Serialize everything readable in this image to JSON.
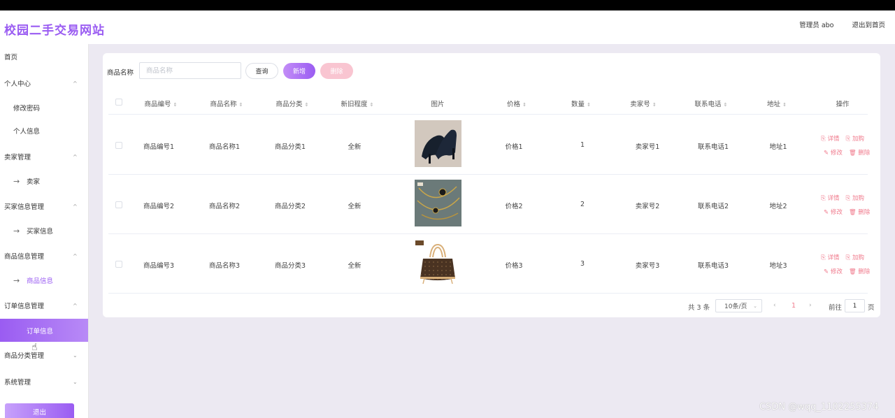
{
  "header": {
    "site_title": "校园二手交易网站",
    "admin_label": "管理员 abo",
    "exit_label": "退出到首页"
  },
  "sidebar": {
    "items": [
      {
        "label": "首页"
      },
      {
        "label": "个人中心"
      },
      {
        "label": "修改密码"
      },
      {
        "label": "个人信息"
      },
      {
        "label": "卖家管理"
      },
      {
        "label": "卖家"
      },
      {
        "label": "买家信息管理"
      },
      {
        "label": "买家信息"
      },
      {
        "label": "商品信息管理"
      },
      {
        "label": "商品信息"
      },
      {
        "label": "订单信息管理"
      },
      {
        "label": "订单信息"
      },
      {
        "label": "商品分类管理"
      },
      {
        "label": "系统管理"
      }
    ],
    "logout_label": "退出"
  },
  "search": {
    "label": "商品名称",
    "placeholder": "商品名称",
    "query_label": "查询",
    "add_label": "新增",
    "delete_label": "删除"
  },
  "table": {
    "columns": [
      "商品编号",
      "商品名称",
      "商品分类",
      "新旧程度",
      "图片",
      "价格",
      "数量",
      "卖家号",
      "联系电话",
      "地址",
      "操作"
    ],
    "rows": [
      {
        "code": "商品编号1",
        "name": "商品名称1",
        "category": "商品分类1",
        "condition": "全新",
        "image": "black-high-heels",
        "price": "价格1",
        "qty": "1",
        "seller": "卖家号1",
        "phone": "联系电话1",
        "address": "地址1"
      },
      {
        "code": "商品编号2",
        "name": "商品名称2",
        "category": "商品分类2",
        "condition": "全新",
        "image": "gold-necklace",
        "price": "价格2",
        "qty": "2",
        "seller": "卖家号2",
        "phone": "联系电话2",
        "address": "地址2"
      },
      {
        "code": "商品编号3",
        "name": "商品名称3",
        "category": "商品分类3",
        "condition": "全新",
        "image": "brown-tote-bag",
        "price": "价格3",
        "qty": "3",
        "seller": "卖家号3",
        "phone": "联系电话3",
        "address": "地址3"
      }
    ],
    "ops": {
      "detail": "详情",
      "cart": "加购",
      "edit": "修改",
      "delete": "删除"
    }
  },
  "pagination": {
    "total": "共 3 条",
    "page_size": "10条/页",
    "current_page": "1",
    "goto_label": "前往",
    "goto_value": "1",
    "page_suffix": "页"
  },
  "watermark": "CSDN @wqq_1102255374",
  "colors": {
    "accent": "#9a5cf2",
    "danger": "#f07b8d"
  }
}
